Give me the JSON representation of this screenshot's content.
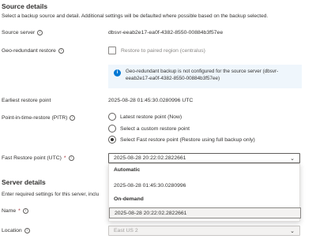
{
  "source_details": {
    "title": "Source details",
    "description": "Select a backup source and detail. Additional settings will be defaulted where possible based on the backup selected.",
    "source_server": {
      "label": "Source server",
      "value": "dbsvr-eeab2e17-ea0f-4382-8550-00884b3f57ee"
    },
    "geo_restore": {
      "label": "Geo-redundant restore",
      "checkbox_label": "Restore to paired region (centralus)",
      "checked": false
    },
    "info_banner": "Geo-redundant backup is not configured for the source server (dbsvr-eeab2e17-ea0f-4382-8550-00884b3f57ee)",
    "earliest_restore": {
      "label": "Earliest restore point",
      "value": "2025-08-28 01:45:30.0280996 UTC"
    },
    "pitr": {
      "label": "Point-in-time-restore (PITR)",
      "options": [
        {
          "label": "Latest restore point (Now)",
          "selected": false
        },
        {
          "label": "Select a custom restore point",
          "selected": false
        },
        {
          "label": "Select Fast restore point (Restore using full backup only)",
          "selected": true
        }
      ]
    },
    "fast_restore": {
      "label": "Fast Restore point (UTC)",
      "required": "*",
      "selected_value": "2025-08-28 20:22:02.2822661",
      "dropdown": {
        "groups": [
          {
            "header": "Automatic",
            "options": [
              "2025-08-28 01:45:30.0280996"
            ]
          },
          {
            "header": "On-demand",
            "options": [
              "2025-08-28 20:22:02.2822661"
            ]
          }
        ]
      }
    }
  },
  "server_details": {
    "title": "Server details",
    "description": "Enter required settings for this server, inclu",
    "name": {
      "label": "Name",
      "required": "*"
    },
    "location": {
      "label": "Location",
      "value": "East US 2"
    }
  },
  "colors": {
    "accent": "#0078d4",
    "required": "#a4262c",
    "info_bg": "#eff6fc"
  }
}
